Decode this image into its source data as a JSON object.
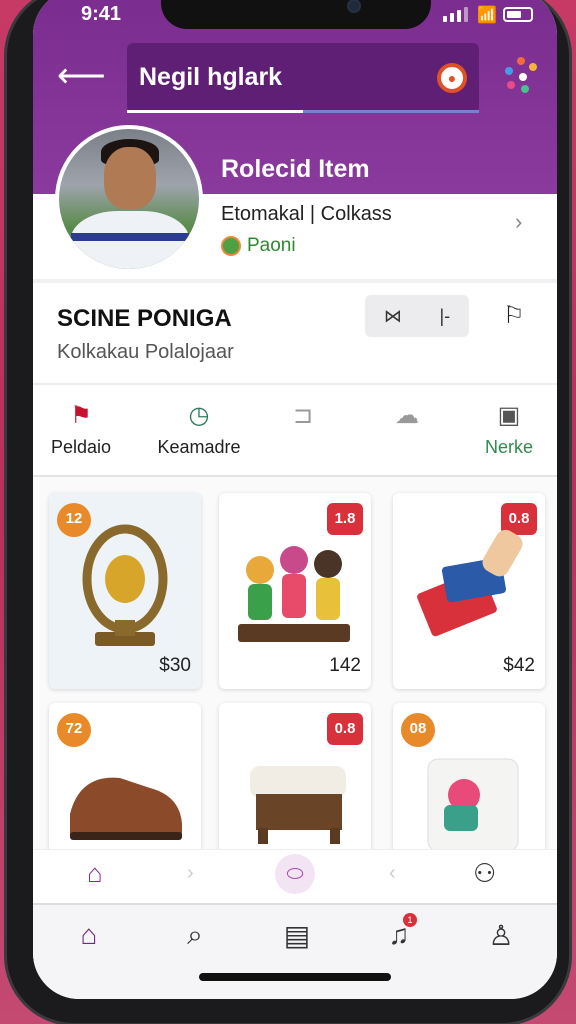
{
  "status": {
    "time": "9:41"
  },
  "header": {
    "search_text": "Negil hglark"
  },
  "profile": {
    "title": "Rolecid Item",
    "subtitle": "Etomakal | Colkass",
    "badge": "Paoni"
  },
  "section": {
    "title": "SCINE PONIGA",
    "subtitle": "Kolkakau Polalojaar",
    "toggle_left": "⋈",
    "toggle_right": "|-"
  },
  "categories": [
    {
      "label": "Peldaio",
      "icon": "flag-icon",
      "color": "#c8102e"
    },
    {
      "label": "Keamadre",
      "icon": "clock-icon",
      "color": "#2f7a5a"
    },
    {
      "label": "",
      "icon": "scan-icon",
      "color": "#999999"
    },
    {
      "label": "",
      "icon": "cloud-icon",
      "color": "#999999"
    },
    {
      "label": "Nerke",
      "icon": "clipboard-icon",
      "color": "#2f8a4f"
    }
  ],
  "products": [
    {
      "tag": "12",
      "price": "$30"
    },
    {
      "tag": "1.8",
      "price": "142"
    },
    {
      "tag": "0.8",
      "price": "$42"
    },
    {
      "tag": "72",
      "price": ""
    },
    {
      "tag": "0.8",
      "price": ""
    },
    {
      "tag": "08",
      "price": ""
    }
  ],
  "nav_badge": "1"
}
